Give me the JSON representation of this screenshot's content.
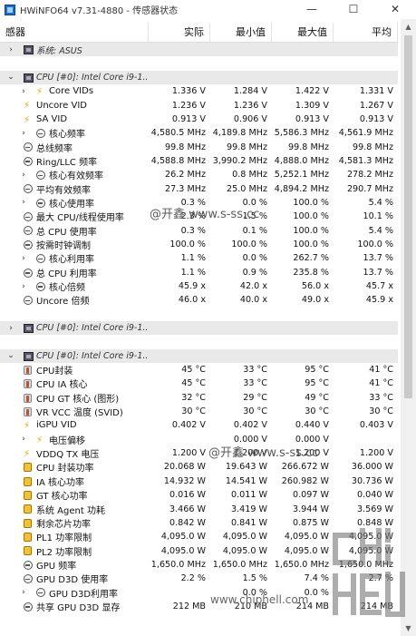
{
  "window": {
    "title": "HWiNFO64 v7.31-4880 - 传感器状态",
    "buttons": {
      "minimize": "—",
      "maximize": "☐",
      "close": "✕"
    }
  },
  "columns": {
    "name": "感器",
    "current": "实际",
    "min": "最小值",
    "max": "最大值",
    "avg": "平均"
  },
  "rows": [
    {
      "type": "group",
      "expander": "›",
      "icon": "chip",
      "name": "系统: ASUS"
    },
    {
      "type": "blank"
    },
    {
      "type": "group",
      "expander": "⌄",
      "icon": "chip",
      "name": "CPU [#0]: Intel Core i9-1..."
    },
    {
      "type": "item",
      "expander": "›",
      "icon": "bolt",
      "indent": 1,
      "name": "Core VIDs",
      "cur": "1.336 V",
      "min": "1.284 V",
      "max": "1.422 V",
      "avg": "1.331 V"
    },
    {
      "type": "item",
      "icon": "bolt",
      "name": "Uncore VID",
      "cur": "1.236 V",
      "min": "1.236 V",
      "max": "1.309 V",
      "avg": "1.267 V"
    },
    {
      "type": "item",
      "icon": "bolt",
      "name": "SA VID",
      "cur": "0.913 V",
      "min": "0.906 V",
      "max": "0.913 V",
      "avg": "0.913 V"
    },
    {
      "type": "item",
      "expander": "›",
      "icon": "clock",
      "indent": 1,
      "name": "核心频率",
      "cur": "4,580.5 MHz",
      "min": "4,189.8 MHz",
      "max": "5,586.3 MHz",
      "avg": "4,561.9 MHz"
    },
    {
      "type": "item",
      "icon": "clock",
      "name": "总线频率",
      "cur": "99.8 MHz",
      "min": "99.8 MHz",
      "max": "99.8 MHz",
      "avg": "99.8 MHz"
    },
    {
      "type": "item",
      "icon": "clock",
      "name": "Ring/LLC 频率",
      "cur": "4,588.8 MHz",
      "min": "3,990.2 MHz",
      "max": "4,888.0 MHz",
      "avg": "4,581.3 MHz"
    },
    {
      "type": "item",
      "expander": "›",
      "icon": "clock",
      "indent": 1,
      "name": "核心有效频率",
      "cur": "26.2 MHz",
      "min": "0.8 MHz",
      "max": "5,252.1 MHz",
      "avg": "278.2 MHz"
    },
    {
      "type": "item",
      "icon": "clock",
      "name": "平均有效频率",
      "cur": "27.3 MHz",
      "min": "25.0 MHz",
      "max": "4,894.2 MHz",
      "avg": "290.7 MHz"
    },
    {
      "type": "item",
      "expander": "›",
      "icon": "clock",
      "indent": 1,
      "name": "核心使用率",
      "cur": "0.3 %",
      "min": "0.0 %",
      "max": "100.0 %",
      "avg": "5.4 %"
    },
    {
      "type": "item",
      "icon": "clock",
      "name": "最大 CPU/线程使用率",
      "cur": "2.3 %",
      "min": "1.5 %",
      "max": "100.0 %",
      "avg": "10.1 %"
    },
    {
      "type": "item",
      "icon": "clock",
      "name": "总 CPU 使用率",
      "cur": "0.3 %",
      "min": "0.1 %",
      "max": "100.0 %",
      "avg": "5.4 %"
    },
    {
      "type": "item",
      "icon": "clock",
      "name": "按需时钟调制",
      "cur": "100.0 %",
      "min": "100.0 %",
      "max": "100.0 %",
      "avg": "100.0 %"
    },
    {
      "type": "item",
      "expander": "›",
      "icon": "clock",
      "indent": 1,
      "name": "核心利用率",
      "cur": "1.1 %",
      "min": "0.0 %",
      "max": "262.7 %",
      "avg": "13.7 %"
    },
    {
      "type": "item",
      "icon": "clock",
      "name": "总 CPU 利用率",
      "cur": "1.1 %",
      "min": "0.9 %",
      "max": "235.8 %",
      "avg": "13.7 %"
    },
    {
      "type": "item",
      "expander": "›",
      "icon": "clock",
      "indent": 1,
      "name": "核心倍频",
      "cur": "45.9 x",
      "min": "42.0 x",
      "max": "56.0 x",
      "avg": "45.7 x"
    },
    {
      "type": "item",
      "icon": "clock",
      "name": "Uncore 倍频",
      "cur": "46.0 x",
      "min": "40.0 x",
      "max": "49.0 x",
      "avg": "45.9 x"
    },
    {
      "type": "blank"
    },
    {
      "type": "group",
      "expander": "›",
      "icon": "chip",
      "name": "CPU [#0]: Intel Core i9-1..."
    },
    {
      "type": "blank"
    },
    {
      "type": "group",
      "expander": "⌄",
      "icon": "chip",
      "name": "CPU [#0]: Intel Core i9-1..."
    },
    {
      "type": "item",
      "icon": "therm",
      "name": "CPU封装",
      "cur": "45 °C",
      "min": "33 °C",
      "max": "95 °C",
      "avg": "41 °C"
    },
    {
      "type": "item",
      "icon": "therm",
      "name": "CPU IA 核心",
      "cur": "45 °C",
      "min": "33 °C",
      "max": "95 °C",
      "avg": "41 °C"
    },
    {
      "type": "item",
      "icon": "therm",
      "name": "CPU GT 核心 (图形)",
      "cur": "32 °C",
      "min": "29 °C",
      "max": "49 °C",
      "avg": "33 °C"
    },
    {
      "type": "item",
      "icon": "therm",
      "name": "VR VCC 温度 (SVID)",
      "cur": "30 °C",
      "min": "30 °C",
      "max": "30 °C",
      "avg": "30 °C"
    },
    {
      "type": "item",
      "icon": "bolt",
      "name": "iGPU VID",
      "cur": "0.402 V",
      "min": "0.402 V",
      "max": "0.440 V",
      "avg": "0.403 V"
    },
    {
      "type": "item",
      "expander": "›",
      "icon": "bolt",
      "indent": 1,
      "name": "电压偏移",
      "cur": "",
      "min": "0.000 V",
      "max": "0.000 V",
      "avg": ""
    },
    {
      "type": "item",
      "icon": "bolt",
      "name": "VDDQ TX 电压",
      "cur": "1.200 V",
      "min": "1.200 V",
      "max": "1.200 V",
      "avg": "1.200 V"
    },
    {
      "type": "item",
      "icon": "plug",
      "name": "CPU 封装功率",
      "cur": "20.068 W",
      "min": "19.643 W",
      "max": "266.672 W",
      "avg": "36.000 W"
    },
    {
      "type": "item",
      "icon": "plug",
      "name": "IA 核心功率",
      "cur": "14.932 W",
      "min": "14.541 W",
      "max": "260.982 W",
      "avg": "30.736 W"
    },
    {
      "type": "item",
      "icon": "plug",
      "name": "GT 核心功率",
      "cur": "0.016 W",
      "min": "0.011 W",
      "max": "0.097 W",
      "avg": "0.040 W"
    },
    {
      "type": "item",
      "icon": "plug",
      "name": "系统 Agent 功耗",
      "cur": "3.466 W",
      "min": "3.419 W",
      "max": "3.944 W",
      "avg": "3.569 W"
    },
    {
      "type": "item",
      "icon": "plug",
      "name": "剩余芯片功率",
      "cur": "0.842 W",
      "min": "0.841 W",
      "max": "0.875 W",
      "avg": "0.848 W"
    },
    {
      "type": "item",
      "icon": "plug",
      "name": "PL1 功率限制",
      "cur": "4,095.0 W",
      "min": "4,095.0 W",
      "max": "4,095.0 W",
      "avg": "4,095.0 W"
    },
    {
      "type": "item",
      "icon": "plug",
      "name": "PL2 功率限制",
      "cur": "4,095.0 W",
      "min": "4,095.0 W",
      "max": "4,095.0 W",
      "avg": "4,095.0 W"
    },
    {
      "type": "item",
      "icon": "clock",
      "name": "GPU 频率",
      "cur": "1,650.0 MHz",
      "min": "1,650.0 MHz",
      "max": "1,650.0 MHz",
      "avg": "1,650.0 MHz"
    },
    {
      "type": "item",
      "icon": "clock",
      "name": "GPU D3D 使用率",
      "cur": "2.2 %",
      "min": "1.5 %",
      "max": "7.4 %",
      "avg": "2.7 %"
    },
    {
      "type": "item",
      "expander": "›",
      "icon": "clock",
      "indent": 1,
      "name": "GPU D3D利用率",
      "cur": "",
      "min": "0.0 %",
      "max": "0.0 %",
      "avg": ""
    },
    {
      "type": "item",
      "icon": "clock",
      "name": "共享 GPU D3D 显存",
      "cur": "212 MB",
      "min": "210 MB",
      "max": "214 MB",
      "avg": "214 MB"
    }
  ],
  "watermarks": [
    "@开鑫 www.s-ss.cc",
    "@开鑫 www.s-ss.cc",
    "www.chiphell.com"
  ],
  "colors": {
    "group_bg": "#e9e9e9",
    "bolt": "#e0a800",
    "row_text": "#111111"
  }
}
